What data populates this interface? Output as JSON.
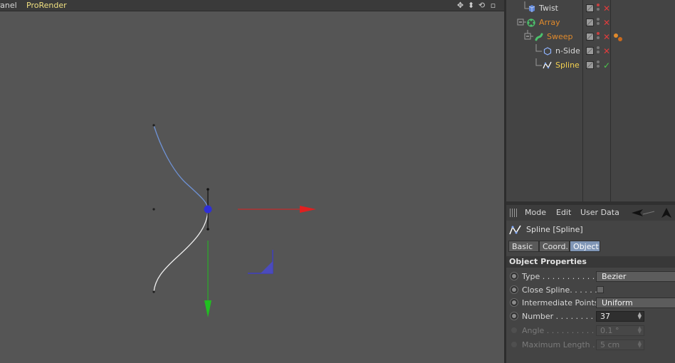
{
  "viewport": {
    "menu": [
      "Panel",
      "ProRender"
    ],
    "nav_icons": [
      "move-view-icon",
      "dolly-view-icon",
      "rotate-view-icon",
      "maximize-view-icon"
    ]
  },
  "object_manager": {
    "objects": [
      {
        "name": "Twist",
        "icon": "twist-deformer-icon",
        "color": "#d8d8d8",
        "state": "✕",
        "state_color": "#e03c3c",
        "dot_top": "#c94040",
        "dot_bottom": "#777777"
      },
      {
        "name": "Array",
        "icon": "array-icon",
        "color": "#e08a2c",
        "state": "✕",
        "state_color": "#e03c3c",
        "dot_top": "#777777",
        "dot_bottom": "#777777"
      },
      {
        "name": "Sweep",
        "icon": "sweep-icon",
        "color": "#e08a2c",
        "state": "✕",
        "state_color": "#e03c3c",
        "dot_top": "#c94040",
        "dot_bottom": "#777777",
        "tag": "material-tag-icon"
      },
      {
        "name": "n-Side",
        "icon": "nside-spline-icon",
        "color": "#d8d8d8",
        "state": "✕",
        "state_color": "#e03c3c",
        "dot_top": "#777777",
        "dot_bottom": "#777777"
      },
      {
        "name": "Spline",
        "icon": "spline-icon",
        "color": "#f2d050",
        "state": "✓",
        "state_color": "#4cc94c",
        "dot_top": "#777777",
        "dot_bottom": "#777777"
      }
    ]
  },
  "attribute_manager": {
    "menu": {
      "mode": "Mode",
      "edit": "Edit",
      "user_data": "User Data"
    },
    "object_title": "Spline [Spline]",
    "tabs": [
      {
        "label": "Basic",
        "active": false
      },
      {
        "label": "Coord.",
        "active": false
      },
      {
        "label": "Object",
        "active": true
      }
    ],
    "section_title": "Object Properties",
    "properties": {
      "type": {
        "label": "Type . . . . . . . . . . . .",
        "value": "Bezier"
      },
      "close_spline": {
        "label": "Close Spline. . . . . .",
        "checked": false
      },
      "intermediate_points": {
        "label": "Intermediate Points",
        "value": "Uniform"
      },
      "number": {
        "label": "Number . . . . . . . . .",
        "value": "37"
      },
      "angle": {
        "label": "Angle . . . . . . . . . . .",
        "value": "0.1 °"
      },
      "maximum_length": {
        "label": "Maximum Length . .",
        "value": "5 cm"
      }
    }
  }
}
